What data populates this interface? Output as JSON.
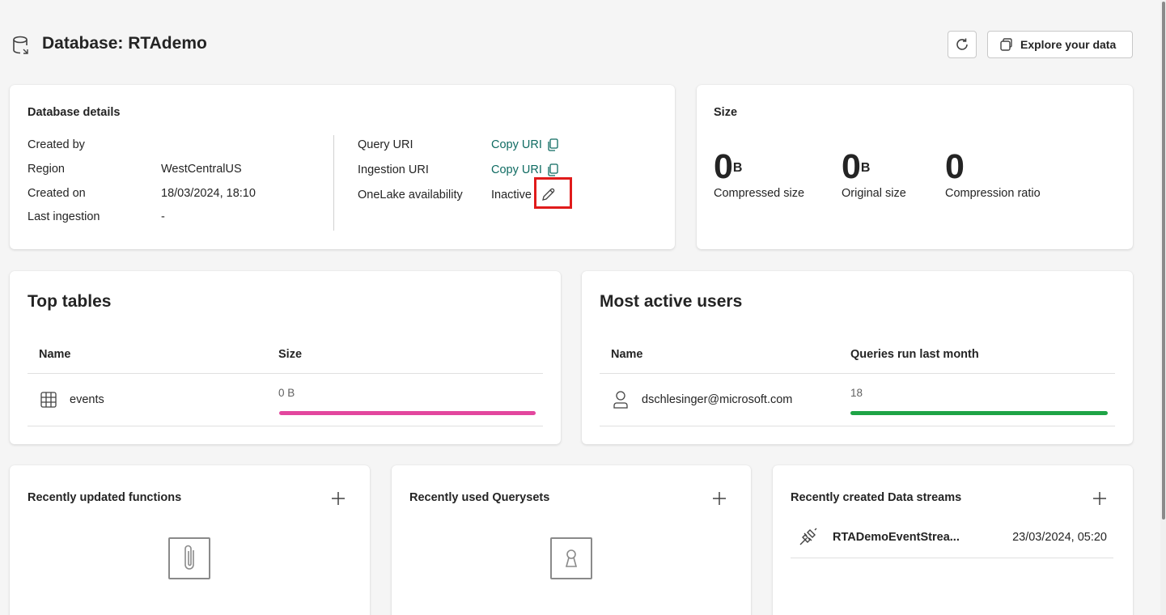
{
  "header": {
    "title": "Database: RTAdemo",
    "explore_label": "Explore your data"
  },
  "details": {
    "heading": "Database details",
    "rows": [
      {
        "label": "Created by",
        "value": ""
      },
      {
        "label": "Region",
        "value": "WestCentralUS"
      },
      {
        "label": "Created on",
        "value": "18/03/2024, 18:10"
      },
      {
        "label": "Last ingestion",
        "value": "-"
      }
    ],
    "query_uri_label": "Query URI",
    "ingestion_uri_label": "Ingestion URI",
    "copy_uri_label": "Copy URI",
    "onelake_label": "OneLake availability",
    "onelake_value": "Inactive"
  },
  "size": {
    "heading": "Size",
    "compressed_value": "0",
    "compressed_unit": "B",
    "compressed_label": "Compressed size",
    "original_value": "0",
    "original_unit": "B",
    "original_label": "Original size",
    "ratio_value": "0",
    "ratio_label": "Compression ratio"
  },
  "top_tables": {
    "heading": "Top tables",
    "col_name": "Name",
    "col_size": "Size",
    "rows": [
      {
        "name": "events",
        "size": "0 B",
        "bar_fraction": 1.0
      }
    ],
    "bar_color": "#e3479e"
  },
  "active_users": {
    "heading": "Most active users",
    "col_name": "Name",
    "col_queries": "Queries run last month",
    "rows": [
      {
        "name": "dschlesinger@microsoft.com",
        "queries": "18",
        "bar_fraction": 1.0
      }
    ],
    "bar_color": "#1ea446"
  },
  "functions": {
    "heading": "Recently updated functions"
  },
  "querysets": {
    "heading": "Recently used Querysets"
  },
  "datastreams": {
    "heading": "Recently created Data streams",
    "items": [
      {
        "name": "RTADemoEventStrea...",
        "date": "23/03/2024, 05:20"
      }
    ]
  },
  "colors": {
    "link": "#0f6b62",
    "highlight": "#e01b1b"
  }
}
